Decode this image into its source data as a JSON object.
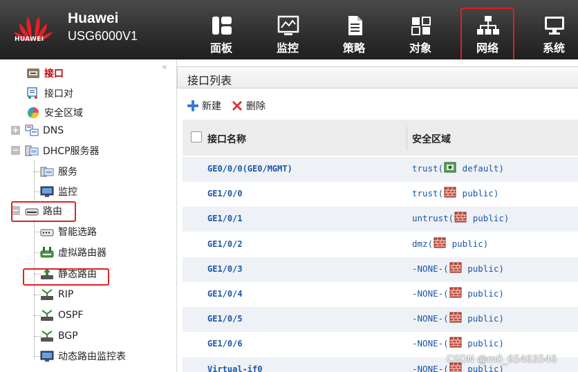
{
  "header": {
    "logo_text": "HUAWEI",
    "brand_name": "Huawei",
    "model": "USG6000V1",
    "nav": [
      {
        "label": "面板",
        "icon": "dashboard-icon"
      },
      {
        "label": "监控",
        "icon": "monitor-chart-icon"
      },
      {
        "label": "策略",
        "icon": "policy-document-icon"
      },
      {
        "label": "对象",
        "icon": "object-icon"
      },
      {
        "label": "网络",
        "icon": "network-topology-icon",
        "active": true
      },
      {
        "label": "系统",
        "icon": "system-monitor-icon"
      }
    ]
  },
  "sidebar": {
    "collapse_glyph": "«",
    "items": [
      {
        "label": "接口",
        "icon": "interface-icon",
        "selected": true
      },
      {
        "label": "接口对",
        "icon": "interface-pair-icon"
      },
      {
        "label": "安全区域",
        "icon": "security-zone-icon"
      },
      {
        "label": "DNS",
        "icon": "dns-icon"
      },
      {
        "label": "DHCP服务器",
        "icon": "dhcp-server-icon"
      },
      {
        "label": "服务",
        "icon": "service-icon"
      },
      {
        "label": "监控",
        "icon": "monitor-icon"
      },
      {
        "label": "路由",
        "icon": "route-icon"
      },
      {
        "label": "智能选路",
        "icon": "smart-route-icon"
      },
      {
        "label": "虚拟路由器",
        "icon": "virtual-router-icon"
      },
      {
        "label": "静态路由",
        "icon": "static-route-icon"
      },
      {
        "label": "RIP",
        "icon": "rip-icon"
      },
      {
        "label": "OSPF",
        "icon": "ospf-icon"
      },
      {
        "label": "BGP",
        "icon": "bgp-icon"
      },
      {
        "label": "动态路由监控表",
        "icon": "dynamic-route-monitor-icon"
      }
    ]
  },
  "main": {
    "title": "接口列表",
    "toolbar": {
      "new_label": "新建",
      "delete_label": "删除"
    },
    "columns": {
      "name": "接口名称",
      "zone": "安全区域"
    },
    "rows": [
      {
        "name": "GE0/0/0(GE0/MGMT)",
        "zone_pre": "trust(",
        "zone_post": " default)",
        "icon": "zone-green-icon"
      },
      {
        "name": "GE1/0/0",
        "zone_pre": "trust(",
        "zone_post": " public)",
        "icon": "firewall-icon"
      },
      {
        "name": "GE1/0/1",
        "zone_pre": "untrust(",
        "zone_post": " public)",
        "icon": "firewall-icon"
      },
      {
        "name": "GE1/0/2",
        "zone_pre": "dmz(",
        "zone_post": " public)",
        "icon": "firewall-icon"
      },
      {
        "name": "GE1/0/3",
        "zone_pre": "-NONE-(",
        "zone_post": " public)",
        "icon": "firewall-icon"
      },
      {
        "name": "GE1/0/4",
        "zone_pre": "-NONE-(",
        "zone_post": " public)",
        "icon": "firewall-icon"
      },
      {
        "name": "GE1/0/5",
        "zone_pre": "-NONE-(",
        "zone_post": " public)",
        "icon": "firewall-icon"
      },
      {
        "name": "GE1/0/6",
        "zone_pre": "-NONE-(",
        "zone_post": " public)",
        "icon": "firewall-icon"
      },
      {
        "name": "Virtual-if0",
        "zone_pre": "-NONE-(",
        "zone_post": " public)",
        "icon": "firewall-icon"
      }
    ]
  },
  "watermark": "CSDN @m0_65463546",
  "colors": {
    "accent_red": "#e02020",
    "link_blue": "#1a56a8",
    "selected_red": "#c00000"
  }
}
